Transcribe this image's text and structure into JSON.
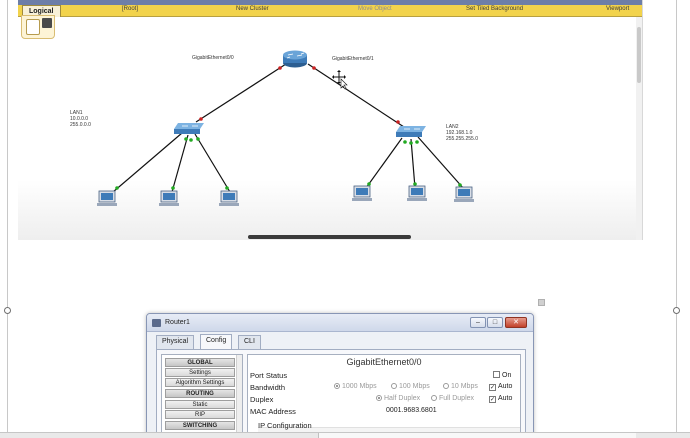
{
  "workspace": {
    "tab": "Logical",
    "toolbar_items": [
      "[Root]",
      "New Cluster",
      "Move Object",
      "Set Tiled Background",
      "Viewport"
    ],
    "router_ports": [
      "GigabitEthernet0/0",
      "GigabitEthernet0/1"
    ],
    "lan1_lines": [
      "LAN1",
      "10.0.0.0",
      "255.0.0.0"
    ],
    "lan2_lines": [
      "LAN2",
      "192.168.1.0",
      "255.255.255.0"
    ]
  },
  "dialog": {
    "title": "Router1",
    "tabs": [
      "Physical",
      "Config",
      "CLI"
    ],
    "active_tab": "Config",
    "left_items": [
      {
        "label": "GLOBAL",
        "header": true
      },
      {
        "label": "Settings",
        "header": false
      },
      {
        "label": "Algorithm Settings",
        "header": false
      },
      {
        "label": "ROUTING",
        "header": true
      },
      {
        "label": "Static",
        "header": false
      },
      {
        "label": "RIP",
        "header": false
      },
      {
        "label": "SWITCHING",
        "header": true
      }
    ],
    "panel_title": "GigabitEthernet0/0",
    "port_status": {
      "label": "Port Status",
      "on_label": "On",
      "checked": false
    },
    "bandwidth": {
      "label": "Bandwidth",
      "options": [
        "1000 Mbps",
        "100 Mbps",
        "10 Mbps"
      ],
      "auto_label": "Auto",
      "auto_checked": true
    },
    "duplex": {
      "label": "Duplex",
      "options": [
        "Half Duplex",
        "Full Duplex"
      ],
      "auto_label": "Auto",
      "auto_checked": true
    },
    "mac": {
      "label": "MAC Address",
      "value": "0001.9683.6801"
    },
    "ip_config_label": "IP Configuration"
  },
  "colors": {
    "toolbar_yellow": "#f2d34c",
    "link_black": "#111111",
    "port_red": "#cc2222",
    "port_green": "#22aa22",
    "device_blue": "#3e7bb8"
  }
}
